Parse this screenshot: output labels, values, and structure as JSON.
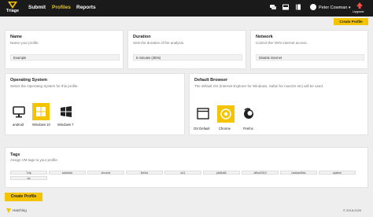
{
  "topbar": {
    "logo_text": "Triage",
    "nav": [
      "Submit",
      "Profiles",
      "Reports"
    ],
    "active_nav": "Profiles",
    "user_name": "Peter Cowman",
    "upgrade_label": "Upgrade",
    "icons": [
      "chat-icon",
      "inbox-icon",
      "book-icon",
      "user-icon",
      "upgrade-icon"
    ]
  },
  "actions": {
    "create_top": "Create Profile",
    "create_bottom": "Create Profile"
  },
  "name_card": {
    "title": "Name",
    "subtitle": "Name your profile.",
    "value": "Example"
  },
  "duration_card": {
    "title": "Duration",
    "subtitle": "Sets the duration of the analysis.",
    "value": "5 minutes (300s)"
  },
  "network_card": {
    "title": "Network",
    "subtitle": "Control the VM's internet access.",
    "value": "Disable internet"
  },
  "os_card": {
    "title": "Operating System",
    "subtitle": "Select the Operating System for this profile.",
    "options": [
      "android",
      "Windows 10",
      "Windows 7"
    ],
    "selected": "Windows 10"
  },
  "browser_card": {
    "title": "Default Browser",
    "subtitle": "The default OS (Internet Explorer for Windows, Safari for macOS etc) will be used.",
    "options": [
      "OS Default",
      "Chrome",
      "Firefox"
    ],
    "selected": "Chrome"
  },
  "tags_card": {
    "title": "Tags",
    "subtitle": "Assign VM tags to your profile.",
    "tags": [
      "7zip",
      "adobedc",
      "chrome",
      "firefox",
      "w11",
      "jdk8u66",
      "office2019",
      "randomfiles",
      "system",
      "vlc"
    ]
  },
  "footer": {
    "brand": "Hatching",
    "copyright": "© 2018-2020"
  },
  "colors": {
    "accent": "#f5c400",
    "topbar": "#1a1a1a",
    "background": "#eeeeee"
  }
}
